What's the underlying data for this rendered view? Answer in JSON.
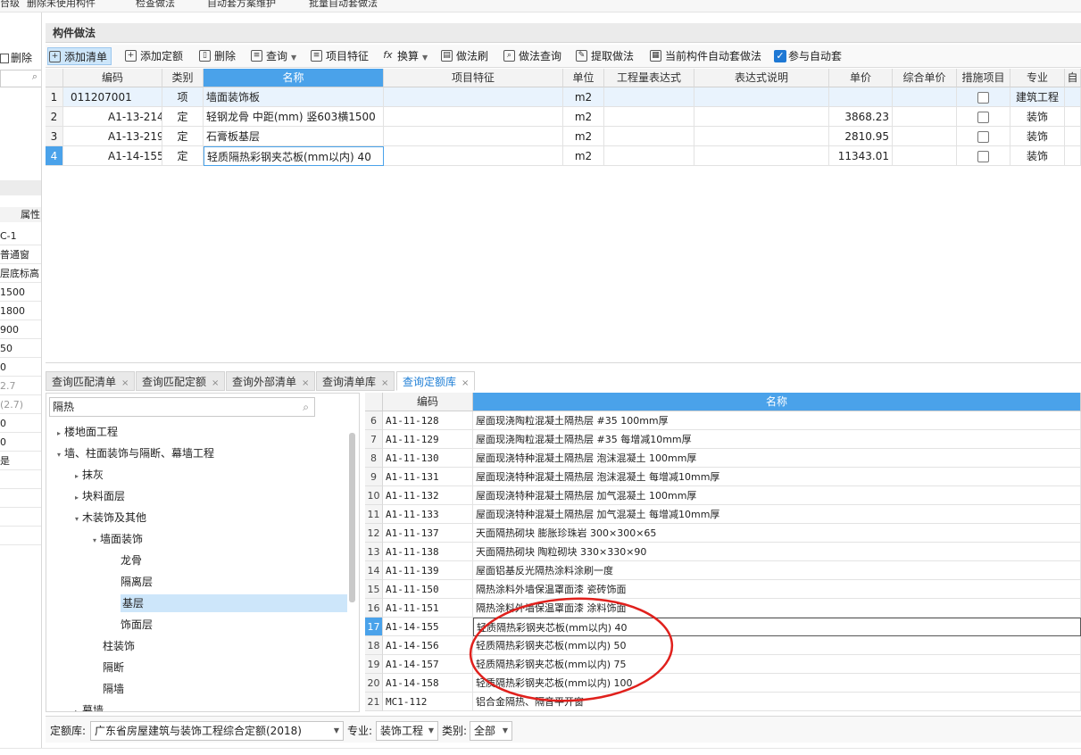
{
  "topbar": {
    "items": [
      "台级",
      "删除未使用构件",
      "检查做法",
      "自动套方案维护",
      "批量自动套做法"
    ]
  },
  "left_panel": {
    "delete_label": "删除",
    "search_icon": "search-icon",
    "header_label": "属性",
    "rows": [
      "C-1",
      "普通窗",
      "层底标高",
      "1500",
      "1800",
      "900",
      "50",
      "0",
      "2.7",
      "(2.7)",
      "0",
      "0",
      "是"
    ]
  },
  "panel_title": "构件做法",
  "toolbar": {
    "add_list": "添加清单",
    "add_quota": "添加定额",
    "delete": "删除",
    "query": "查询",
    "item_feature": "项目特征",
    "convert": "换算",
    "method_brush": "做法刷",
    "method_query": "做法查询",
    "extract_method": "提取做法",
    "auto_set": "当前构件自动套做法",
    "participate_auto": "参与自动套",
    "participate_checked": true
  },
  "grid": {
    "headers": [
      "编码",
      "类别",
      "名称",
      "项目特征",
      "单位",
      "工程量表达式",
      "表达式说明",
      "单价",
      "综合单价",
      "措施项目",
      "专业",
      "自"
    ],
    "rows": [
      {
        "num": "1",
        "code": "011207001",
        "type": "项",
        "name": "墙面装饰板",
        "feature": "",
        "unit": "m2",
        "expr": "",
        "expr_desc": "",
        "price": "",
        "total": "",
        "measure": false,
        "major": "建筑工程"
      },
      {
        "num": "2",
        "code": "A1-13-214",
        "type": "定",
        "name": "轻钢龙骨 中距(mm) 竖603横1500",
        "feature": "",
        "unit": "m2",
        "expr": "",
        "expr_desc": "",
        "price": "3868.23",
        "total": "",
        "measure": false,
        "major": "装饰"
      },
      {
        "num": "3",
        "code": "A1-13-219",
        "type": "定",
        "name": "石膏板基层",
        "feature": "",
        "unit": "m2",
        "expr": "",
        "expr_desc": "",
        "price": "2810.95",
        "total": "",
        "measure": false,
        "major": "装饰"
      },
      {
        "num": "4",
        "code": "A1-14-155",
        "type": "定",
        "name": "轻质隔热彩钢夹芯板(mm以内) 40",
        "feature": "",
        "unit": "m2",
        "expr": "",
        "expr_desc": "",
        "price": "11343.01",
        "total": "",
        "measure": false,
        "major": "装饰"
      }
    ]
  },
  "tabs": [
    "查询匹配清单",
    "查询匹配定额",
    "查询外部清单",
    "查询清单库",
    "查询定额库"
  ],
  "tree": {
    "search_value": "隔热",
    "nodes": [
      "楼地面工程",
      "墙、柱面装饰与隔断、幕墙工程",
      "抹灰",
      "块料面层",
      "木装饰及其他",
      "墙面装饰",
      "龙骨",
      "隔离层",
      "基层",
      "饰面层",
      "柱装饰",
      "隔断",
      "隔墙",
      "幕墙"
    ]
  },
  "results": {
    "headers": [
      "编码",
      "名称"
    ],
    "rows": [
      {
        "n": "6",
        "code": "A1-11-128",
        "name": "屋面现浇陶粒混凝土隔热层 #35 100mm厚"
      },
      {
        "n": "7",
        "code": "A1-11-129",
        "name": "屋面现浇陶粒混凝土隔热层 #35 每增减10mm厚"
      },
      {
        "n": "8",
        "code": "A1-11-130",
        "name": "屋面现浇特种混凝土隔热层 泡沫混凝土 100mm厚"
      },
      {
        "n": "9",
        "code": "A1-11-131",
        "name": "屋面现浇特种混凝土隔热层 泡沫混凝土 每增减10mm厚"
      },
      {
        "n": "10",
        "code": "A1-11-132",
        "name": "屋面现浇特种混凝土隔热层 加气混凝土 100mm厚"
      },
      {
        "n": "11",
        "code": "A1-11-133",
        "name": "屋面现浇特种混凝土隔热层 加气混凝土 每增减10mm厚"
      },
      {
        "n": "12",
        "code": "A1-11-137",
        "name": "天面隔热砌块 膨胀珍珠岩 300×300×65"
      },
      {
        "n": "13",
        "code": "A1-11-138",
        "name": "天面隔热砌块 陶粒砌块 330×330×90"
      },
      {
        "n": "14",
        "code": "A1-11-139",
        "name": "屋面铝基反光隔热涂料涂刷一度"
      },
      {
        "n": "15",
        "code": "A1-11-150",
        "name": "隔热涂料外墙保温罩面漆 瓷砖饰面"
      },
      {
        "n": "16",
        "code": "A1-11-151",
        "name": "隔热涂料外墙保温罩面漆 涂料饰面"
      },
      {
        "n": "17",
        "code": "A1-14-155",
        "name": "轻质隔热彩钢夹芯板(mm以内) 40"
      },
      {
        "n": "18",
        "code": "A1-14-156",
        "name": "轻质隔热彩钢夹芯板(mm以内) 50"
      },
      {
        "n": "19",
        "code": "A1-14-157",
        "name": "轻质隔热彩钢夹芯板(mm以内) 75"
      },
      {
        "n": "20",
        "code": "A1-14-158",
        "name": "轻质隔热彩钢夹芯板(mm以内) 100"
      },
      {
        "n": "21",
        "code": "MC1-112",
        "name": "铝合金隔热、隔音平开窗"
      }
    ]
  },
  "statusbar": {
    "quota_lib_label": "定额库:",
    "quota_lib_value": "广东省房屋建筑与装饰工程综合定额(2018)",
    "major_label": "专业:",
    "major_value": "装饰工程",
    "category_label": "类别:",
    "category_value": "全部"
  },
  "colors": {
    "accent": "#4aa2ea",
    "selection": "#cde6fa",
    "annotation": "#e0201c"
  }
}
